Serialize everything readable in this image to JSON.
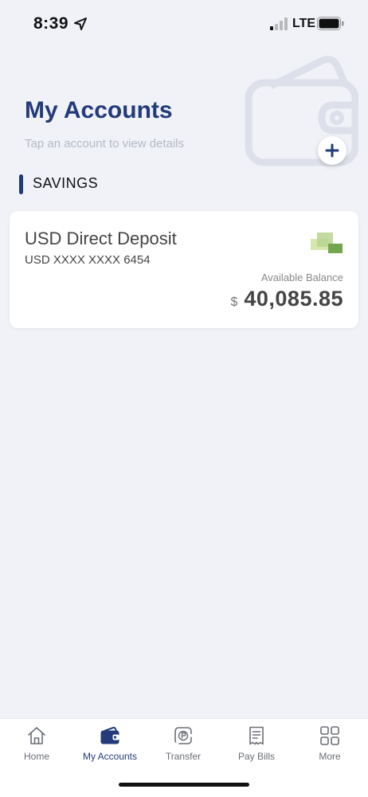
{
  "status_bar": {
    "time": "8:39",
    "network": "LTE"
  },
  "header": {
    "title": "My Accounts",
    "subtitle": "Tap an account to view details",
    "add_button_label": "+"
  },
  "section": {
    "title": "SAVINGS"
  },
  "account": {
    "name": "USD Direct Deposit",
    "number": "USD XXXX XXXX 6454",
    "balance_label": "Available Balance",
    "currency_symbol": "$",
    "balance": "40,085.85"
  },
  "tabs": [
    {
      "label": "Home",
      "icon": "home-icon",
      "active": false
    },
    {
      "label": "My Accounts",
      "icon": "wallet-icon",
      "active": true
    },
    {
      "label": "Transfer",
      "icon": "transfer-icon",
      "active": false
    },
    {
      "label": "Pay Bills",
      "icon": "bill-icon",
      "active": false
    },
    {
      "label": "More",
      "icon": "grid-icon",
      "active": false
    }
  ],
  "colors": {
    "brand": "#233b7b",
    "background": "#f0f2f7",
    "card": "#ffffff",
    "money_green": "#7fae5a"
  }
}
